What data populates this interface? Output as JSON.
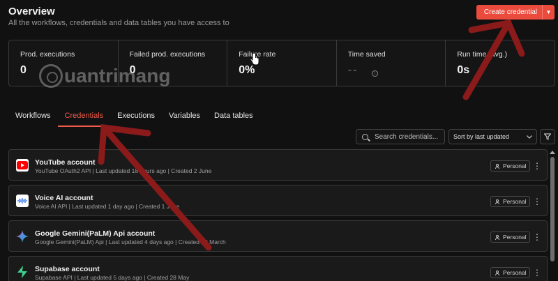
{
  "header": {
    "title": "Overview",
    "subtitle": "All the workflows, credentials and data tables you have access to",
    "create_label": "Create credential"
  },
  "stats": [
    {
      "label": "Prod. executions",
      "value": "0"
    },
    {
      "label": "Failed prod. executions",
      "value": "0"
    },
    {
      "label": "Failure rate",
      "value": "0%"
    },
    {
      "label": "Time saved",
      "value": "--"
    },
    {
      "label": "Run time (avg.)",
      "value": "0s"
    }
  ],
  "watermark": {
    "text": "uantrimang"
  },
  "tabs": [
    {
      "label": "Workflows",
      "active": false
    },
    {
      "label": "Credentials",
      "active": true
    },
    {
      "label": "Executions",
      "active": false
    },
    {
      "label": "Variables",
      "active": false
    },
    {
      "label": "Data tables",
      "active": false
    }
  ],
  "toolbar": {
    "search_placeholder": "Search credentials...",
    "sort_value": "Sort by last updated"
  },
  "credentials": [
    {
      "name": "YouTube account",
      "meta": "YouTube OAuth2 API | Last updated 18 hours ago | Created 2 June",
      "badge": "Personal",
      "icon": "youtube-icon"
    },
    {
      "name": "Voice AI account",
      "meta": "Voice AI API | Last updated 1 day ago | Created 1 June",
      "badge": "Personal",
      "icon": "voice-ai-icon"
    },
    {
      "name": "Google Gemini(PaLM) Api account",
      "meta": "Google Gemini(PaLM) Api | Last updated 4 days ago | Created 29 March",
      "badge": "Personal",
      "icon": "gemini-icon"
    },
    {
      "name": "Supabase account",
      "meta": "Supabase API | Last updated 5 days ago | Created 28 May",
      "badge": "Personal",
      "icon": "supabase-icon"
    }
  ],
  "colors": {
    "accent": "#ea4b3d",
    "annotation": "#8b1a1a"
  }
}
